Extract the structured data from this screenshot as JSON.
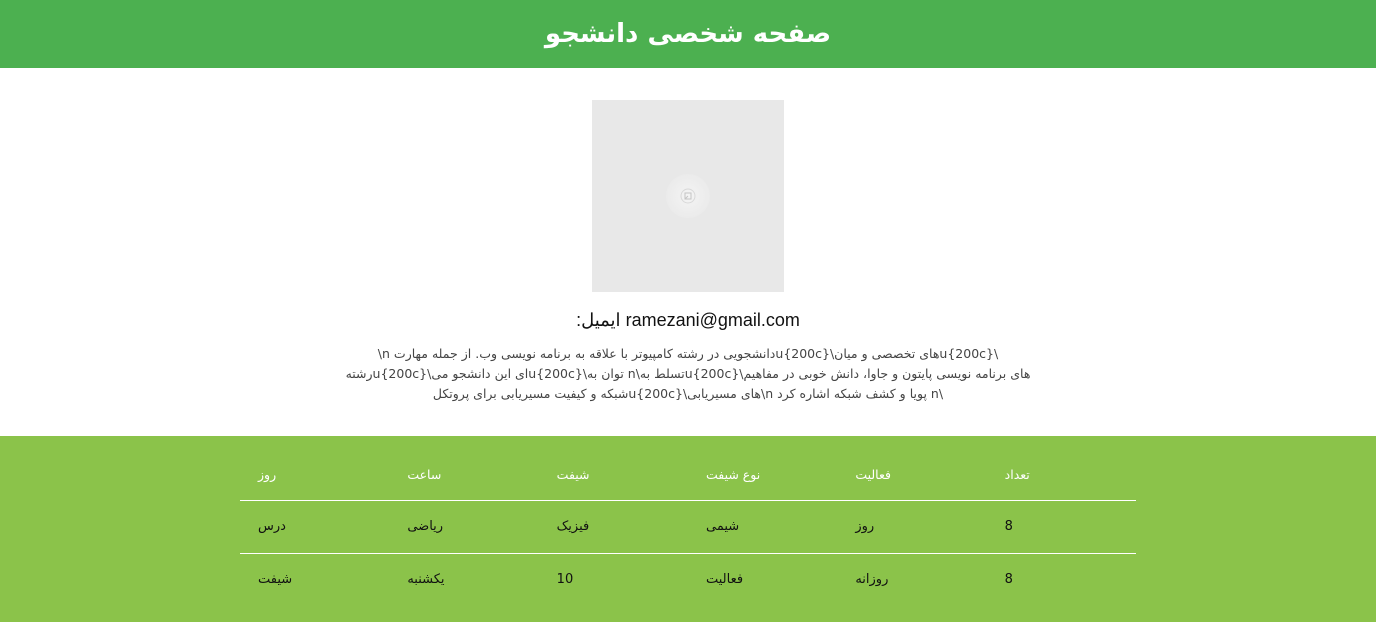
{
  "header": {
    "title": "صفحه شخصی دانشجو"
  },
  "profile": {
    "email_label": "ایمیل:",
    "email": "ramezani@gmail.com",
    "bio_lines": [
      "\\u{200c}های تخصصی و میان\\u{200c}دانشجویی در رشته کامپیوتر با علاقه به برنامه نویسی وب. از جمله مهارت n\\",
      "های برنامه نویسی پایتون و جاوا، دانش خوبی در مفاهیم\\u{200c}تسلط به\\n توان به\\u{200c}ای این دانشجو می\\u{200c}رشته",
      "\\n پویا و کشف شبکه اشاره کرد n\\های مسیریابی\\u{200c}شبکه و کیفیت مسیریابی برای پروتکل"
    ]
  },
  "table": {
    "headers": [
      "روز",
      "ساعت",
      "شیفت",
      "نوع شیفت",
      "فعالیت",
      "تعداد"
    ],
    "rows": [
      [
        "درس",
        "ریاضی",
        "فیزیک",
        "شیمی",
        "روز",
        "8"
      ],
      [
        "شیفت",
        "یکشنبه",
        "10",
        "فعالیت",
        "روزانه",
        "8"
      ]
    ]
  },
  "colors": {
    "header_bg": "#4cb050",
    "table_bg": "#8bc34a",
    "avatar_bg": "#e8e8e8"
  },
  "icons": {
    "avatar": "image-placeholder-icon"
  }
}
